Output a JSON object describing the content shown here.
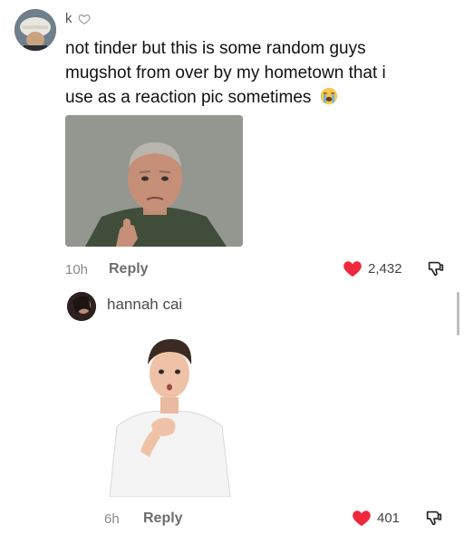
{
  "comments": [
    {
      "username": "k",
      "text_lines": [
        "not tinder but this is some random guys",
        "mugshot from over by my hometown that i",
        "use as a reaction pic sometimes"
      ],
      "emoji": "loudly-crying-face",
      "time": "10h",
      "reply_label": "Reply",
      "likes": "2,432"
    },
    {
      "username": "hannah cai",
      "time": "6h",
      "reply_label": "Reply",
      "likes": "401"
    }
  ],
  "colors": {
    "heart": "#f0283c",
    "muted": "#8a8a8a",
    "text": "#111111"
  }
}
